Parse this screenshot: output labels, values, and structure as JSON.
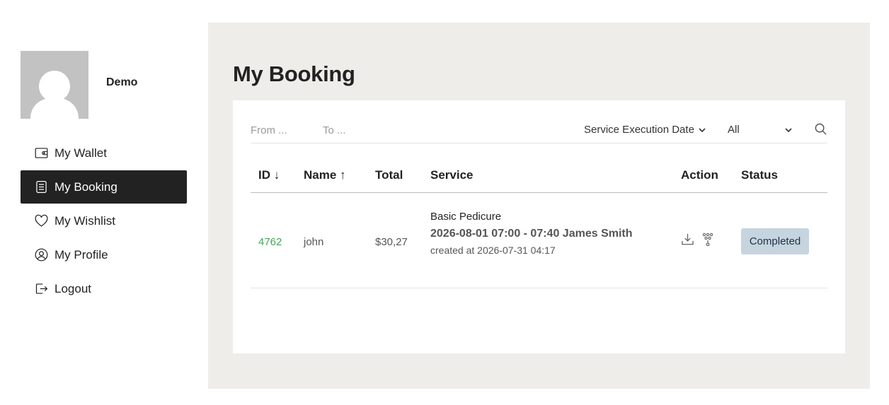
{
  "user": {
    "name": "Demo"
  },
  "sidebar": {
    "items": [
      {
        "label": "My Wallet",
        "icon": "wallet-icon"
      },
      {
        "label": "My Booking",
        "icon": "document-icon",
        "active": true
      },
      {
        "label": "My Wishlist",
        "icon": "heart-icon"
      },
      {
        "label": "My Profile",
        "icon": "user-circle-icon"
      },
      {
        "label": "Logout",
        "icon": "logout-icon"
      }
    ]
  },
  "main": {
    "title": "My Booking",
    "filters": {
      "from_placeholder": "From ...",
      "to_placeholder": "To ...",
      "date_type": "Service Execution Date",
      "status": "All"
    },
    "table": {
      "headers": {
        "id": "ID ↓",
        "name": "Name ↑",
        "total": "Total",
        "service": "Service",
        "action": "Action",
        "status": "Status"
      },
      "rows": [
        {
          "id": "4762",
          "name": "john",
          "total": "$30,27",
          "service_name": "Basic Pedicure",
          "service_time": "2026-08-01 07:00 - 07:40 James Smith",
          "created": "created at 2026-07-31 04:17",
          "status": "Completed"
        }
      ]
    }
  },
  "colors": {
    "panel_bg": "#eeedea",
    "active_nav_bg": "#222222",
    "id_link": "#45a55a",
    "badge_bg": "#c6d4df"
  }
}
